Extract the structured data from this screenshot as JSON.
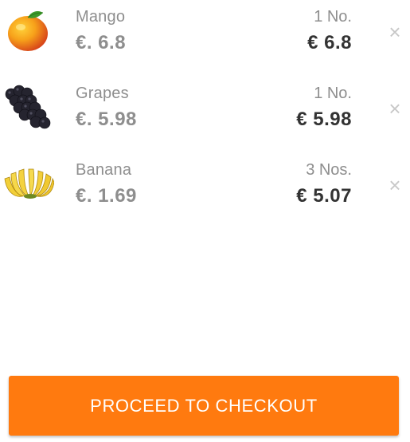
{
  "cart": {
    "items": [
      {
        "name": "Mango",
        "unit_price": "€. 6.8",
        "quantity": "1 No.",
        "total": "€ 6.8",
        "remove_label": "×",
        "image": "mango-image"
      },
      {
        "name": "Grapes",
        "unit_price": "€. 5.98",
        "quantity": "1 No.",
        "total": "€ 5.98",
        "remove_label": "×",
        "image": "grapes-image"
      },
      {
        "name": "Banana",
        "unit_price": "€. 1.69",
        "quantity": "3 Nos.",
        "total": "€ 5.07",
        "remove_label": "×",
        "image": "banana-image"
      }
    ]
  },
  "checkout": {
    "label": "PROCEED TO CHECKOUT",
    "color": "#ff7a0f"
  },
  "colors": {
    "muted_text": "#8e8e8e",
    "total_text": "#333333",
    "remove_icon": "#c8c8c8"
  }
}
